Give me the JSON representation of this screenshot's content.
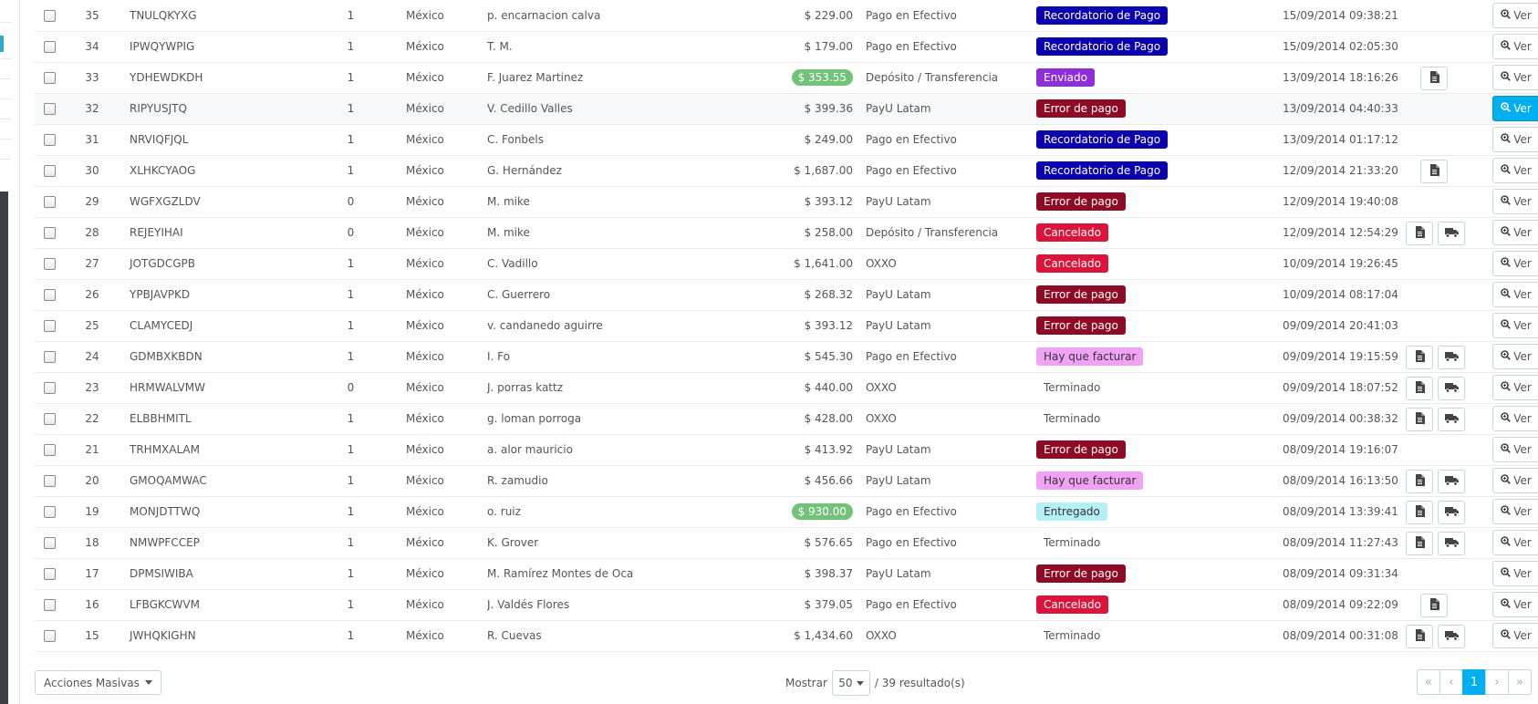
{
  "status_colors": {
    "recordatorio": "#0b00b0",
    "enviado": "#8e2edb",
    "error": "#8e0a25",
    "cancelado": "#dc143c",
    "facturar": "#f1a2f5",
    "entregado": "#b6f0f7"
  },
  "rows": [
    {
      "id": "35",
      "reference": "TNULQKYXG",
      "new_client": "1",
      "country": "México",
      "customer": "p. encarnacion calva",
      "total": "$ 229.00",
      "total_highlight": false,
      "payment": "Pago en Efectivo",
      "status": "Recordatorio de Pago",
      "status_kind": "recordatorio",
      "date": "15/09/2014 09:38:21",
      "icons": []
    },
    {
      "id": "34",
      "reference": "IPWQYWPIG",
      "new_client": "1",
      "country": "México",
      "customer": "T. M.",
      "total": "$ 179.00",
      "total_highlight": false,
      "payment": "Pago en Efectivo",
      "status": "Recordatorio de Pago",
      "status_kind": "recordatorio",
      "date": "15/09/2014 02:05:30",
      "icons": []
    },
    {
      "id": "33",
      "reference": "YDHEWDKDH",
      "new_client": "1",
      "country": "México",
      "customer": "F. Juarez Martinez",
      "total": "$ 353.55",
      "total_highlight": true,
      "payment": "Depósito / Transferencia",
      "status": "Enviado",
      "status_kind": "enviado",
      "date": "13/09/2014 18:16:26",
      "icons": [
        "invoice-icon"
      ]
    },
    {
      "id": "32",
      "reference": "RIPYUSJTQ",
      "new_client": "1",
      "country": "México",
      "customer": "V. Cedillo Valles",
      "total": "$ 399.36",
      "total_highlight": false,
      "payment": "PayU Latam",
      "status": "Error de pago",
      "status_kind": "error",
      "date": "13/09/2014 04:40:33",
      "icons": [],
      "hover": true
    },
    {
      "id": "31",
      "reference": "NRVIQFJQL",
      "new_client": "1",
      "country": "México",
      "customer": "C. Fonbels",
      "total": "$ 249.00",
      "total_highlight": false,
      "payment": "Pago en Efectivo",
      "status": "Recordatorio de Pago",
      "status_kind": "recordatorio",
      "date": "13/09/2014 01:17:12",
      "icons": []
    },
    {
      "id": "30",
      "reference": "XLHKCYAOG",
      "new_client": "1",
      "country": "México",
      "customer": "G. Hernández",
      "total": "$ 1,687.00",
      "total_highlight": false,
      "payment": "Pago en Efectivo",
      "status": "Recordatorio de Pago",
      "status_kind": "recordatorio",
      "date": "12/09/2014 21:33:20",
      "icons": [
        "invoice-icon"
      ]
    },
    {
      "id": "29",
      "reference": "WGFXGZLDV",
      "new_client": "0",
      "country": "México",
      "customer": "M. mike",
      "total": "$ 393.12",
      "total_highlight": false,
      "payment": "PayU Latam",
      "status": "Error de pago",
      "status_kind": "error",
      "date": "12/09/2014 19:40:08",
      "icons": []
    },
    {
      "id": "28",
      "reference": "REJEYIHAI",
      "new_client": "0",
      "country": "México",
      "customer": "M. mike",
      "total": "$ 258.00",
      "total_highlight": false,
      "payment": "Depósito / Transferencia",
      "status": "Cancelado",
      "status_kind": "cancelado",
      "date": "12/09/2014 12:54:29",
      "icons": [
        "invoice-icon",
        "truck-icon"
      ]
    },
    {
      "id": "27",
      "reference": "JOTGDCGPB",
      "new_client": "1",
      "country": "México",
      "customer": "C. Vadillo",
      "total": "$ 1,641.00",
      "total_highlight": false,
      "payment": "OXXO",
      "status": "Cancelado",
      "status_kind": "cancelado",
      "date": "10/09/2014 19:26:45",
      "icons": []
    },
    {
      "id": "26",
      "reference": "YPBJAVPKD",
      "new_client": "1",
      "country": "México",
      "customer": "C. Guerrero",
      "total": "$ 268.32",
      "total_highlight": false,
      "payment": "PayU Latam",
      "status": "Error de pago",
      "status_kind": "error",
      "date": "10/09/2014 08:17:04",
      "icons": []
    },
    {
      "id": "25",
      "reference": "CLAMYCEDJ",
      "new_client": "1",
      "country": "México",
      "customer": "v. candanedo aguirre",
      "total": "$ 393.12",
      "total_highlight": false,
      "payment": "PayU Latam",
      "status": "Error de pago",
      "status_kind": "error",
      "date": "09/09/2014 20:41:03",
      "icons": []
    },
    {
      "id": "24",
      "reference": "GDMBXKBDN",
      "new_client": "1",
      "country": "México",
      "customer": "I. Fo",
      "total": "$ 545.30",
      "total_highlight": false,
      "payment": "Pago en Efectivo",
      "status": "Hay que facturar",
      "status_kind": "facturar",
      "date": "09/09/2014 19:15:59",
      "icons": [
        "invoice-icon",
        "truck-icon"
      ]
    },
    {
      "id": "23",
      "reference": "HRMWALVMW",
      "new_client": "0",
      "country": "México",
      "customer": "J. porras kattz",
      "total": "$ 440.00",
      "total_highlight": false,
      "payment": "OXXO",
      "status": "Terminado",
      "status_kind": "plain",
      "date": "09/09/2014 18:07:52",
      "icons": [
        "invoice-icon",
        "truck-icon"
      ]
    },
    {
      "id": "22",
      "reference": "ELBBHMITL",
      "new_client": "1",
      "country": "México",
      "customer": "g. loman porroga",
      "total": "$ 428.00",
      "total_highlight": false,
      "payment": "OXXO",
      "status": "Terminado",
      "status_kind": "plain",
      "date": "09/09/2014 00:38:32",
      "icons": [
        "invoice-icon",
        "truck-icon"
      ]
    },
    {
      "id": "21",
      "reference": "TRHMXALAM",
      "new_client": "1",
      "country": "México",
      "customer": "a. alor mauricio",
      "total": "$ 413.92",
      "total_highlight": false,
      "payment": "PayU Latam",
      "status": "Error de pago",
      "status_kind": "error",
      "date": "08/09/2014 19:16:07",
      "icons": []
    },
    {
      "id": "20",
      "reference": "GMOQAMWAC",
      "new_client": "1",
      "country": "México",
      "customer": "R. zamudio",
      "total": "$ 456.66",
      "total_highlight": false,
      "payment": "PayU Latam",
      "status": "Hay que facturar",
      "status_kind": "facturar",
      "date": "08/09/2014 16:13:50",
      "icons": [
        "invoice-icon",
        "truck-icon"
      ]
    },
    {
      "id": "19",
      "reference": "MONJDTTWQ",
      "new_client": "1",
      "country": "México",
      "customer": "o. ruiz",
      "total": "$ 930.00",
      "total_highlight": true,
      "payment": "Pago en Efectivo",
      "status": "Entregado",
      "status_kind": "entregado",
      "date": "08/09/2014 13:39:41",
      "icons": [
        "invoice-icon",
        "truck-icon"
      ]
    },
    {
      "id": "18",
      "reference": "NMWPFCCEP",
      "new_client": "1",
      "country": "México",
      "customer": "K. Grover",
      "total": "$ 576.65",
      "total_highlight": false,
      "payment": "Pago en Efectivo",
      "status": "Terminado",
      "status_kind": "plain",
      "date": "08/09/2014 11:27:43",
      "icons": [
        "invoice-icon",
        "truck-icon"
      ]
    },
    {
      "id": "17",
      "reference": "DPMSIWIBA",
      "new_client": "1",
      "country": "México",
      "customer": "M. Ramírez Montes de Oca",
      "total": "$ 398.37",
      "total_highlight": false,
      "payment": "PayU Latam",
      "status": "Error de pago",
      "status_kind": "error",
      "date": "08/09/2014 09:31:34",
      "icons": []
    },
    {
      "id": "16",
      "reference": "LFBGKCWVM",
      "new_client": "1",
      "country": "México",
      "customer": "J. Valdés Flores",
      "total": "$ 379.05",
      "total_highlight": false,
      "payment": "Pago en Efectivo",
      "status": "Cancelado",
      "status_kind": "cancelado",
      "date": "08/09/2014 09:22:09",
      "icons": [
        "invoice-icon"
      ]
    },
    {
      "id": "15",
      "reference": "JWHQKIGHN",
      "new_client": "1",
      "country": "México",
      "customer": "R. Cuevas",
      "total": "$ 1,434.60",
      "total_highlight": false,
      "payment": "OXXO",
      "status": "Terminado",
      "status_kind": "plain",
      "date": "08/09/2014 00:31:08",
      "icons": [
        "invoice-icon",
        "truck-icon"
      ]
    }
  ],
  "view_label": "Ver",
  "footer": {
    "bulk_actions_label": "Acciones Masivas",
    "show_label": "Mostrar",
    "per_page": "50",
    "results_text": "/ 39 resultado(s)",
    "pagination": {
      "first": "«",
      "prev": "‹",
      "current": "1",
      "next": "›",
      "last": "»"
    }
  }
}
